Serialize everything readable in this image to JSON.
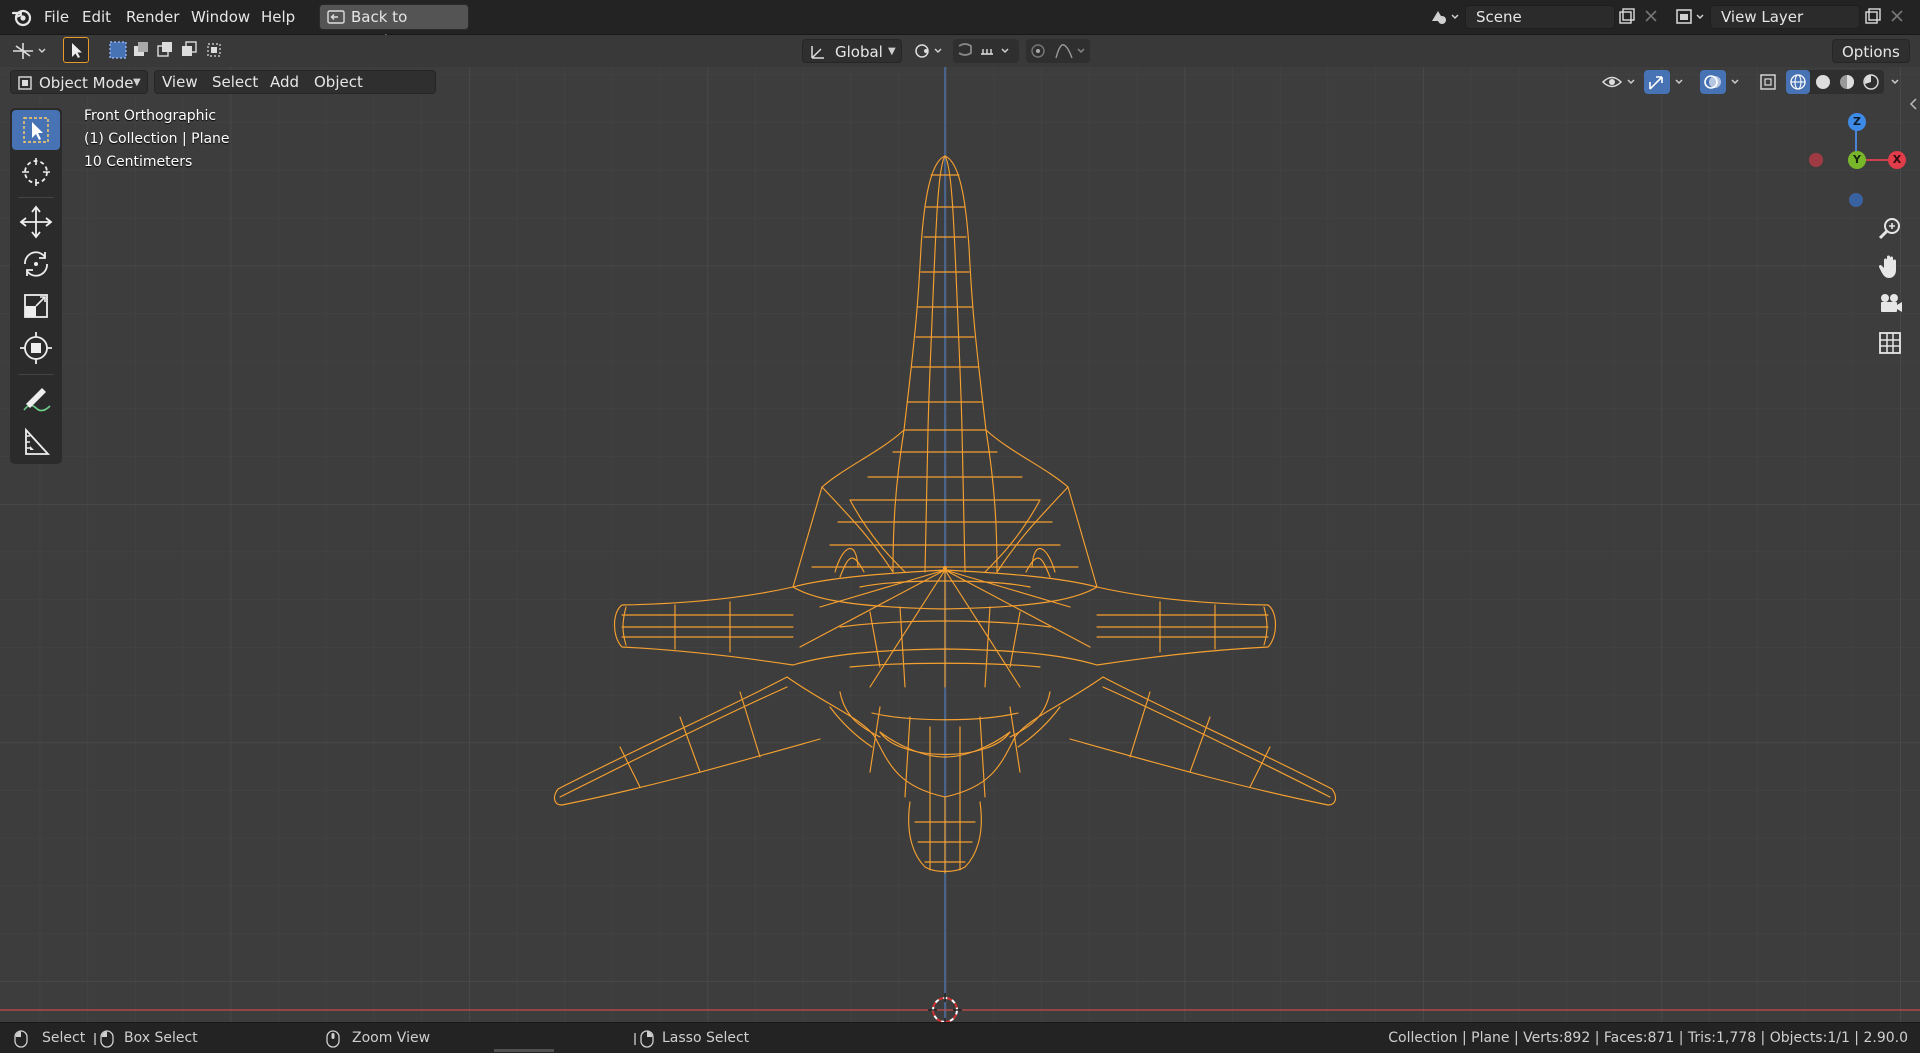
{
  "menubar": {
    "items": [
      "File",
      "Edit",
      "Render",
      "Window",
      "Help"
    ],
    "back_button": "Back to Previous",
    "scene_field": "Scene",
    "view_layer_field": "View Layer"
  },
  "tool_header": {
    "orientation": "Global",
    "options_label": "Options"
  },
  "view_header": {
    "mode": "Object Mode",
    "menus": [
      "View",
      "Select",
      "Add",
      "Object"
    ]
  },
  "viewport": {
    "view_name": "Front Orthographic",
    "collection_info": "(1) Collection | Plane",
    "grid_scale": "10 Centimeters",
    "axis_labels": {
      "z": "Z",
      "y": "Y",
      "x": "X"
    },
    "wire_color": "#f5a030"
  },
  "statusbar": {
    "select": "Select",
    "box_select": "Box Select",
    "zoom_view": "Zoom View",
    "lasso_select": "Lasso Select",
    "stats": "Collection | Plane | Verts:892 | Faces:871 | Tris:1,778 | Objects:1/1 | 2.90.0"
  }
}
